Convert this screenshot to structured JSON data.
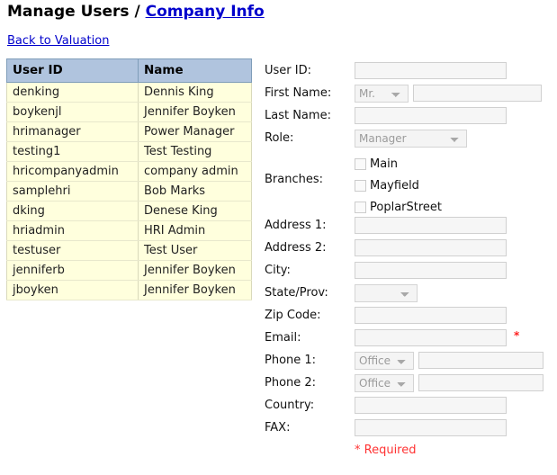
{
  "header": {
    "title_main": "Manage Users",
    "separator": "/",
    "company_link": "Company Info",
    "back_link": "Back to Valuation"
  },
  "users_table": {
    "columns": [
      "User ID",
      "Name"
    ],
    "rows": [
      {
        "user_id": "denking",
        "name": "Dennis King"
      },
      {
        "user_id": "boykenjl",
        "name": "Jennifer Boyken"
      },
      {
        "user_id": "hrimanager",
        "name": "Power Manager"
      },
      {
        "user_id": "testing1",
        "name": "Test Testing"
      },
      {
        "user_id": "hricompanyadmin",
        "name": "company admin"
      },
      {
        "user_id": "samplehri",
        "name": "Bob Marks"
      },
      {
        "user_id": "dking",
        "name": "Denese King"
      },
      {
        "user_id": "hriadmin",
        "name": "HRI Admin"
      },
      {
        "user_id": "testuser",
        "name": "Test User"
      },
      {
        "user_id": "jenniferb",
        "name": "Jennifer Boyken"
      },
      {
        "user_id": "jboyken",
        "name": "Jennifer Boyken"
      }
    ]
  },
  "form": {
    "user_id": {
      "label": "User ID:",
      "value": "",
      "placeholder": ""
    },
    "first_name": {
      "label": "First Name:",
      "title_value": "Mr.",
      "value": "",
      "placeholder": ""
    },
    "last_name": {
      "label": "Last Name:",
      "value": "",
      "placeholder": ""
    },
    "role": {
      "label": "Role:",
      "value": "Manager"
    },
    "branches": {
      "label": "Branches:",
      "items": [
        {
          "label": "Main",
          "checked": false
        },
        {
          "label": "Mayfield",
          "checked": false
        },
        {
          "label": "PoplarStreet",
          "checked": false
        }
      ]
    },
    "address1": {
      "label": "Address 1:",
      "value": ""
    },
    "address2": {
      "label": "Address 2:",
      "value": ""
    },
    "city": {
      "label": "City:",
      "value": ""
    },
    "state_prov": {
      "label": "State/Prov:",
      "value": ""
    },
    "zip_code": {
      "label": "Zip Code:",
      "value": ""
    },
    "email": {
      "label": "Email:",
      "value": "",
      "required_marker": "*"
    },
    "phone1": {
      "label": "Phone 1:",
      "type_value": "Office",
      "value": ""
    },
    "phone2": {
      "label": "Phone 2:",
      "type_value": "Office",
      "value": ""
    },
    "country": {
      "label": "Country:",
      "value": ""
    },
    "fax": {
      "label": "FAX:",
      "value": ""
    },
    "required_note": "* Required"
  },
  "colors": {
    "table_header_bg": "#b0c4de",
    "table_row_bg": "#ffffdd",
    "table_border": "#7f9db9",
    "link": "#0000cc",
    "required_red": "#ff3333"
  }
}
